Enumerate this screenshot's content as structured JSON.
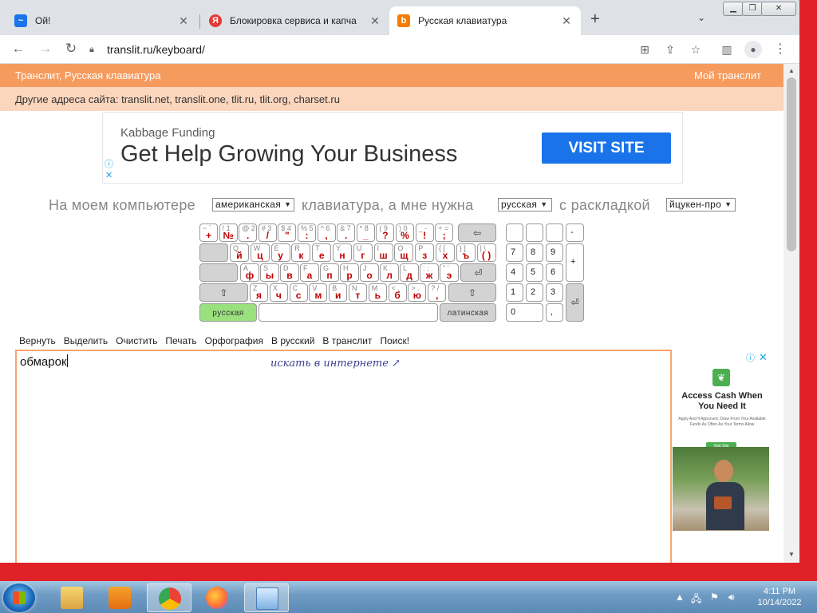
{
  "browser": {
    "tabs": [
      {
        "title": "Ой!",
        "icon": "edge-favicon",
        "color": "#1a73e8"
      },
      {
        "title": "Блокировка сервиса и капча",
        "icon": "yandex-favicon",
        "color": "#e53935"
      },
      {
        "title": "Русская клавиатура",
        "icon": "translit-favicon",
        "color": "#f57c00"
      }
    ],
    "url": "translit.ru/keyboard/",
    "window_buttons": [
      "minimize",
      "restore",
      "close"
    ]
  },
  "site": {
    "brand_left": "Транслит, Русская клавиатура",
    "brand_right": "Мой транслит",
    "alt_addresses": "Другие адреса сайта: translit.net, translit.one, tlit.ru, tlit.org, charset.ru"
  },
  "ad_top": {
    "advertiser": "Kabbage Funding",
    "headline": "Get Help Growing Your Business",
    "cta": "VISIT SITE"
  },
  "kb_sentence": {
    "p1": "На моем компьютере",
    "sel1": "американская",
    "p2": "клавиатура, а мне нужна",
    "sel2": "русская",
    "p3": "с раскладкой",
    "sel3": "йцукен-про"
  },
  "keyboard": {
    "row1": [
      {
        "en": "~ `",
        "ru": "+"
      },
      {
        "en": "! 1",
        "ru": "№"
      },
      {
        "en": "@ 2",
        "ru": "."
      },
      {
        "en": "# 3",
        "ru": "/"
      },
      {
        "en": "$ 4",
        "ru": "\""
      },
      {
        "en": "% 5",
        "ru": ":"
      },
      {
        "en": "^ 6",
        "ru": ","
      },
      {
        "en": "& 7",
        "ru": "."
      },
      {
        "en": "* 8",
        "ru": "_"
      },
      {
        "en": "( 9",
        "ru": "?"
      },
      {
        "en": ") 0",
        "ru": "%"
      },
      {
        "en": "_ -",
        "ru": "!"
      },
      {
        "en": "+ =",
        "ru": ";"
      }
    ],
    "row2": [
      {
        "en": "Q",
        "ru": "й"
      },
      {
        "en": "W",
        "ru": "ц"
      },
      {
        "en": "E",
        "ru": "у"
      },
      {
        "en": "R",
        "ru": "к"
      },
      {
        "en": "T",
        "ru": "е"
      },
      {
        "en": "Y",
        "ru": "н"
      },
      {
        "en": "U",
        "ru": "г"
      },
      {
        "en": "I",
        "ru": "ш"
      },
      {
        "en": "O",
        "ru": "щ"
      },
      {
        "en": "P",
        "ru": "з"
      },
      {
        "en": "{ [",
        "ru": "х"
      },
      {
        "en": "} ]",
        "ru": "ъ"
      },
      {
        "en": "| \\",
        "ru": "( )"
      }
    ],
    "row3": [
      {
        "en": "A",
        "ru": "ф"
      },
      {
        "en": "S",
        "ru": "ы"
      },
      {
        "en": "D",
        "ru": "в"
      },
      {
        "en": "F",
        "ru": "а"
      },
      {
        "en": "G",
        "ru": "п"
      },
      {
        "en": "H",
        "ru": "р"
      },
      {
        "en": "J",
        "ru": "о"
      },
      {
        "en": "K",
        "ru": "л"
      },
      {
        "en": "L",
        "ru": "д"
      },
      {
        "en": ": ;",
        "ru": "ж"
      },
      {
        "en": "\" '",
        "ru": "э"
      }
    ],
    "row4": [
      {
        "en": "Z",
        "ru": "я"
      },
      {
        "en": "X",
        "ru": "ч"
      },
      {
        "en": "C",
        "ru": "с"
      },
      {
        "en": "V",
        "ru": "м"
      },
      {
        "en": "B",
        "ru": "и"
      },
      {
        "en": "N",
        "ru": "т"
      },
      {
        "en": "M",
        "ru": "ь"
      },
      {
        "en": "< ,",
        "ru": "б"
      },
      {
        "en": "> .",
        "ru": "ю"
      },
      {
        "en": "? /",
        "ru": ","
      }
    ],
    "lang_ru": "русская",
    "lang_en": "латинская",
    "numpad": [
      "7",
      "8",
      "9",
      "4",
      "5",
      "6",
      "1",
      "2",
      "3",
      "0",
      ",",
      "-",
      "+"
    ]
  },
  "tools": [
    "Вернуть",
    "Выделить",
    "Очистить",
    "Печать",
    "Орфография",
    "В русский",
    "В транслит",
    "Поиск!"
  ],
  "editor": {
    "value": "обмарок",
    "hint": "искать в интернете"
  },
  "ad_side": {
    "headline": "Access Cash When You Need It",
    "sub": "Apply And If Approved, Draw From Your Available Funds As Often As Your Terms Allow",
    "cta": "Visit Site"
  },
  "taskbar": {
    "time": "4:11 PM",
    "date": "10/14/2022",
    "apps": [
      "explorer",
      "media-player",
      "chrome",
      "firefox",
      "control-panel"
    ]
  },
  "colors": {
    "accent_orange": "#f69b5e",
    "alt_bar": "#fcd5bd",
    "key_red": "#c00000",
    "desktop_red": "#e02128"
  }
}
